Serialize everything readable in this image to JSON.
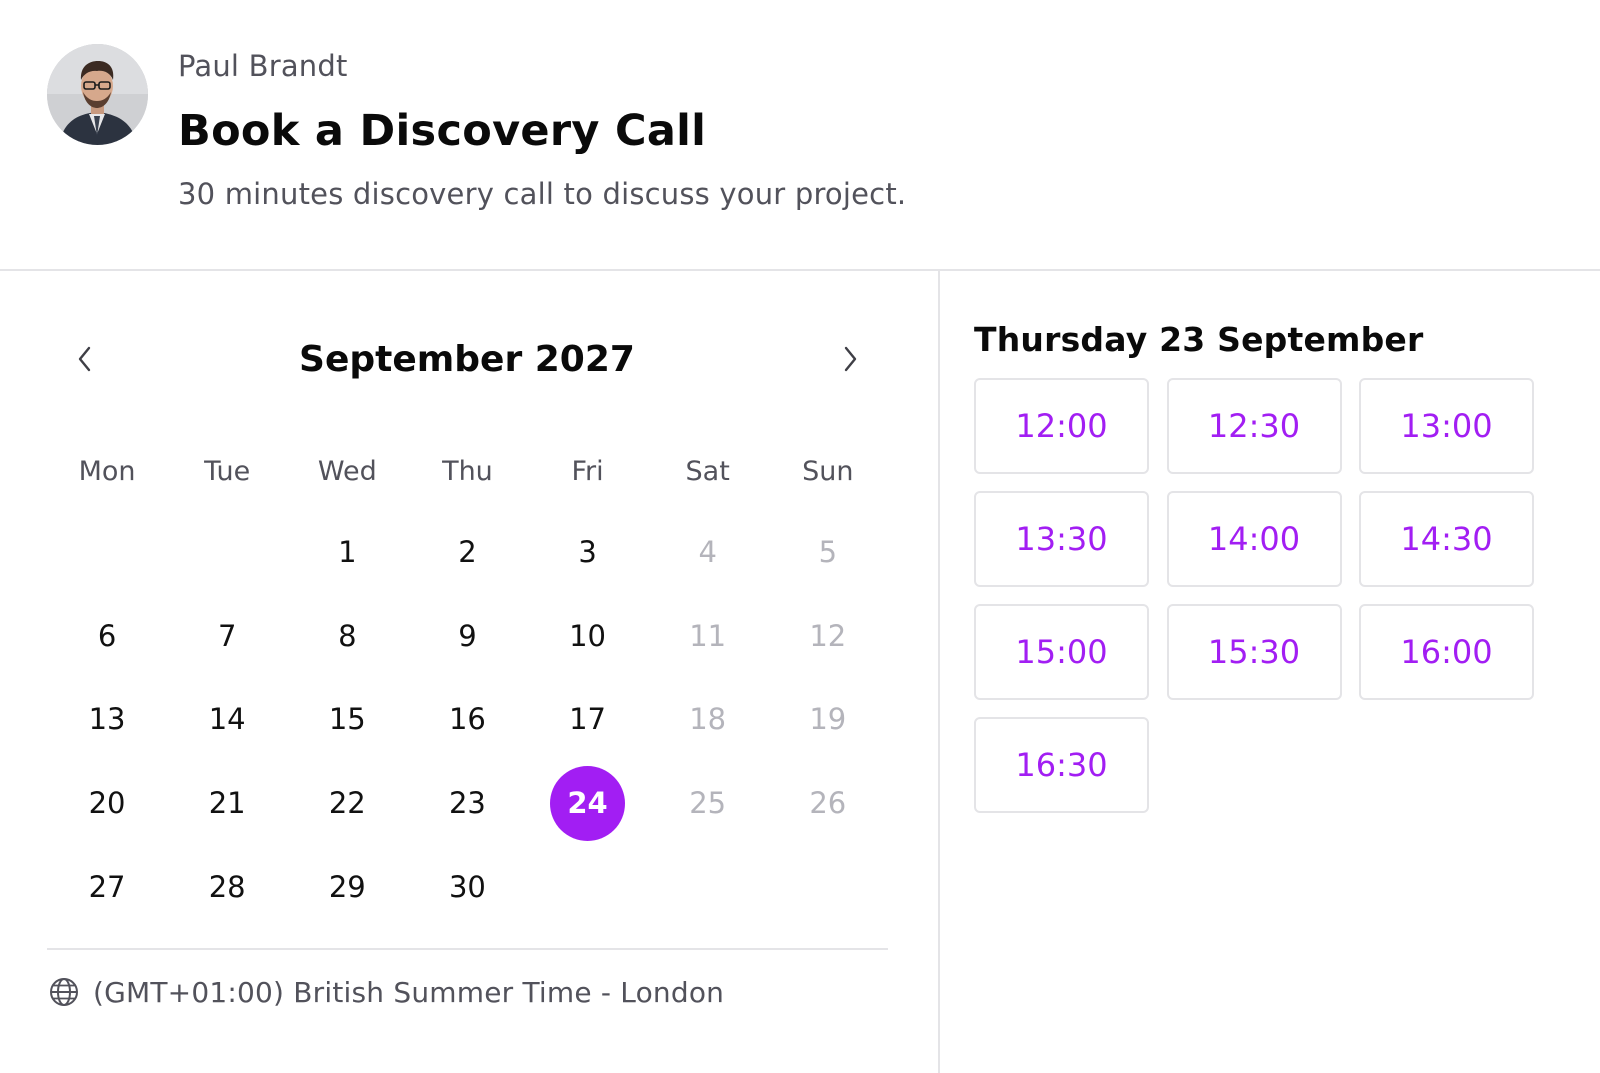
{
  "host": {
    "name": "Paul Brandt"
  },
  "event": {
    "title": "Book a Discovery Call",
    "description": "30 minutes discovery call to discuss your project."
  },
  "calendar": {
    "month_label": "September 2027",
    "weekdays": [
      "Mon",
      "Tue",
      "Wed",
      "Thu",
      "Fri",
      "Sat",
      "Sun"
    ],
    "leading_empty": 2,
    "days": [
      {
        "n": "1",
        "state": "available"
      },
      {
        "n": "2",
        "state": "available"
      },
      {
        "n": "3",
        "state": "available"
      },
      {
        "n": "4",
        "state": "disabled"
      },
      {
        "n": "5",
        "state": "disabled"
      },
      {
        "n": "6",
        "state": "available"
      },
      {
        "n": "7",
        "state": "available"
      },
      {
        "n": "8",
        "state": "available"
      },
      {
        "n": "9",
        "state": "available"
      },
      {
        "n": "10",
        "state": "available"
      },
      {
        "n": "11",
        "state": "disabled"
      },
      {
        "n": "12",
        "state": "disabled"
      },
      {
        "n": "13",
        "state": "available"
      },
      {
        "n": "14",
        "state": "available"
      },
      {
        "n": "15",
        "state": "available"
      },
      {
        "n": "16",
        "state": "available"
      },
      {
        "n": "17",
        "state": "available"
      },
      {
        "n": "18",
        "state": "disabled"
      },
      {
        "n": "19",
        "state": "disabled"
      },
      {
        "n": "20",
        "state": "available"
      },
      {
        "n": "21",
        "state": "available"
      },
      {
        "n": "22",
        "state": "available"
      },
      {
        "n": "23",
        "state": "available"
      },
      {
        "n": "24",
        "state": "selected"
      },
      {
        "n": "25",
        "state": "disabled"
      },
      {
        "n": "26",
        "state": "disabled"
      },
      {
        "n": "27",
        "state": "available"
      },
      {
        "n": "28",
        "state": "available"
      },
      {
        "n": "29",
        "state": "available"
      },
      {
        "n": "30",
        "state": "available"
      }
    ],
    "prev_icon": "chevron-left-icon",
    "next_icon": "chevron-right-icon"
  },
  "timezone": {
    "icon": "globe-icon",
    "label": "(GMT+01:00) British Summer Time - London"
  },
  "times": {
    "date_heading": "Thursday 23 September",
    "slots": [
      "12:00",
      "12:30",
      "13:00",
      "13:30",
      "14:00",
      "14:30",
      "15:00",
      "15:30",
      "16:00",
      "16:30"
    ]
  },
  "colors": {
    "accent": "#a21ef3",
    "border": "#e4e4e7",
    "muted_text": "#52525b",
    "disabled_text": "#b4b4bb"
  }
}
